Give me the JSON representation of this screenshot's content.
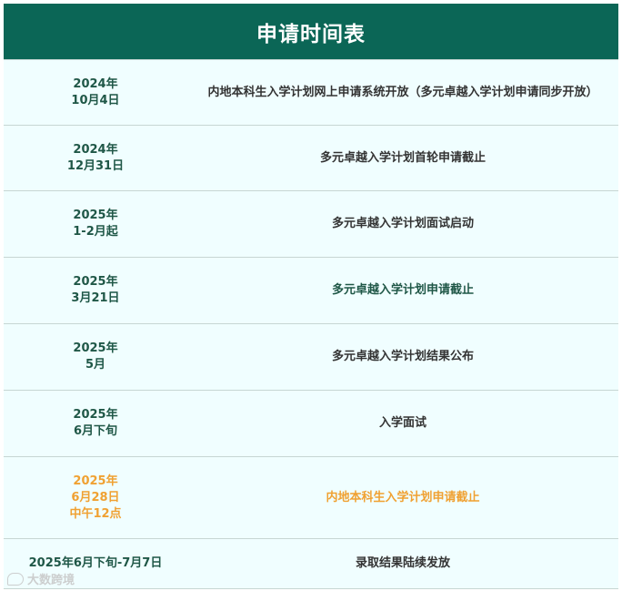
{
  "header": {
    "title": "申请时间表"
  },
  "rows": [
    {
      "date_lines": [
        "2024年",
        "10月4日"
      ],
      "event": "内地本科生入学计划网上申请系统开放（多元卓越入学计划申请同步开放）",
      "style": "dark"
    },
    {
      "date_lines": [
        "2024年",
        "12月31日"
      ],
      "event": "多元卓越入学计划首轮申请截止",
      "style": "dark"
    },
    {
      "date_lines": [
        "2025年",
        "1-2月起"
      ],
      "event": "多元卓越入学计划面试启动",
      "style": "dark"
    },
    {
      "date_lines": [
        "2025年",
        "3月21日"
      ],
      "event": "多元卓越入学计划申请截止",
      "style": "green"
    },
    {
      "date_lines": [
        "2025年",
        "5月"
      ],
      "event": "多元卓越入学计划结果公布",
      "style": "dark"
    },
    {
      "date_lines": [
        "2025年",
        "6月下旬"
      ],
      "event": "入学面试",
      "style": "dark"
    },
    {
      "date_lines": [
        "2025年",
        "6月28日",
        "中午12点"
      ],
      "event": "内地本科生入学计划申请截止",
      "style": "orange"
    },
    {
      "date_lines": [
        "2025年6月下旬-7月7日"
      ],
      "event": "录取结果陆续发放",
      "style": "dark"
    }
  ],
  "watermark": {
    "text": "大数跨境"
  },
  "colors": {
    "header_bg": "#0b6656",
    "row_bg": "#f0feff",
    "date_text": "#1f5747",
    "event_text": "#333333",
    "highlight_orange": "#f0a132",
    "divider": "#c7d6d3"
  }
}
